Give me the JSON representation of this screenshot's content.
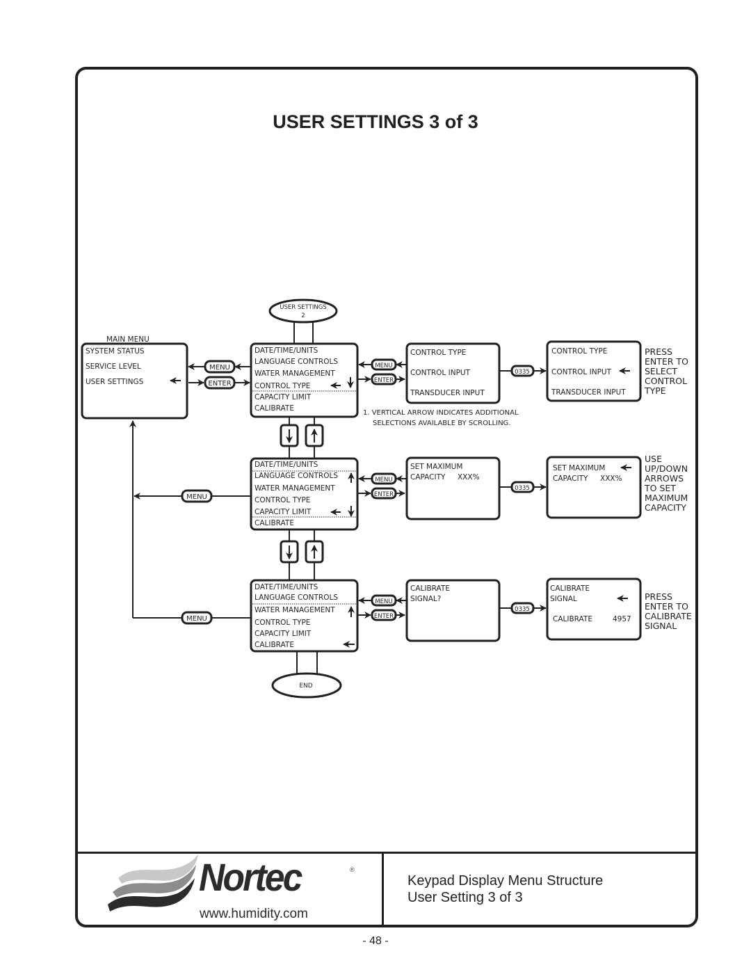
{
  "page": {
    "title": "USER SETTINGS 3 of 3",
    "page_number": "- 48 -"
  },
  "footer": {
    "brand": "Nortec",
    "registered_mark": "®",
    "url": "www.humidity.com",
    "description_line1": "Keypad Display Menu Structure",
    "description_line2": "User Setting 3 of 3"
  },
  "diagram": {
    "start_node": {
      "line1": "USER SETTINGS",
      "line2": "2"
    },
    "end_node": "END",
    "main_menu": {
      "label": "MAIN MENU",
      "items": [
        "SYSTEM STATUS",
        "SERVICE LEVEL",
        "USER SETTINGS"
      ]
    },
    "user_menu_items": [
      "DATE/TIME/UNITS",
      "LANGUAGE CONTROLS",
      "WATER MANAGEMENT",
      "CONTROL TYPE",
      "CAPACITY LIMIT",
      "CALIBRATE"
    ],
    "keys": {
      "menu": "MENU",
      "enter": "ENTER",
      "password": "0335",
      "down": "↓",
      "up": "↑"
    },
    "row1": {
      "screen_a": [
        "CONTROL TYPE",
        "CONTROL INPUT",
        "TRANSDUCER INPUT"
      ],
      "screen_b": [
        "CONTROL TYPE",
        "CONTROL INPUT",
        "TRANSDUCER INPUT"
      ],
      "instruction": [
        "PRESS",
        "ENTER TO",
        "SELECT",
        "CONTROL",
        "TYPE"
      ]
    },
    "note": {
      "line1": "1. VERTICAL ARROW INDICATES ADDITIONAL",
      "line2": "SELECTIONS AVAILABLE BY SCROLLING."
    },
    "row2": {
      "screen_a": {
        "line1": "SET MAXIMUM",
        "label": "CAPACITY",
        "value": "XXX%"
      },
      "screen_b": {
        "line1": "SET MAXIMUM",
        "label": "CAPACITY",
        "value": "XXX%"
      },
      "instruction": [
        "USE",
        "UP/DOWN",
        "ARROWS",
        "TO SET",
        "MAXIMUM",
        "CAPACITY"
      ]
    },
    "row3": {
      "screen_a": [
        "CALIBRATE",
        "SIGNAL?"
      ],
      "screen_b": {
        "line1": "CALIBRATE",
        "line2": "SIGNAL",
        "label": "CALIBRATE",
        "value": "4957"
      },
      "instruction": [
        "PRESS",
        "ENTER TO",
        "CALIBRATE",
        "SIGNAL"
      ]
    }
  }
}
